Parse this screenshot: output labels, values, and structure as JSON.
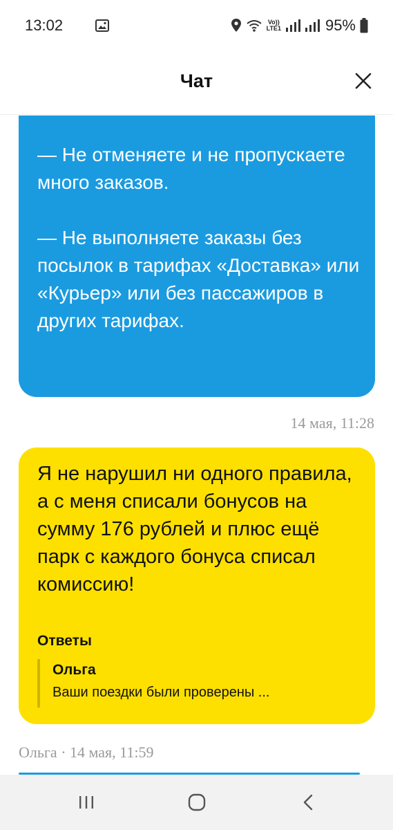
{
  "status_bar": {
    "time": "13:02",
    "lte_top": "Vo))",
    "lte_bottom": "LTE1",
    "battery": "95%",
    "icons": [
      "gallery-icon",
      "location-icon",
      "wifi-icon",
      "volte-icon",
      "signal-icon",
      "signal-icon",
      "battery-icon"
    ]
  },
  "header": {
    "title": "Чат",
    "close_icon": "close-icon"
  },
  "messages": {
    "support": {
      "text": "— Не отменяете и не пропускаете много заказов.\n\n— Не выполняете заказы без посылок в тарифах «Доставка» или «Курьер» или без пассажиров в других тарифах.",
      "color": "#1a9be0"
    },
    "support_time": "14 мая, 11:28",
    "user": {
      "text": "Я не нарушил ни одного правила, а с меня списали бонусов на сумму 176 рублей и плюс ещё парк с каждого бонуса списал комиссию!",
      "color": "#fde000",
      "replies_heading": "Ответы",
      "reply": {
        "author": "Ольга",
        "preview": "Ваши поездки были проверены ..."
      }
    },
    "next_meta": "Ольга · 14 мая, 11:59"
  },
  "nav_bar": {
    "buttons": [
      "recent-apps-icon",
      "home-icon",
      "back-icon"
    ]
  }
}
